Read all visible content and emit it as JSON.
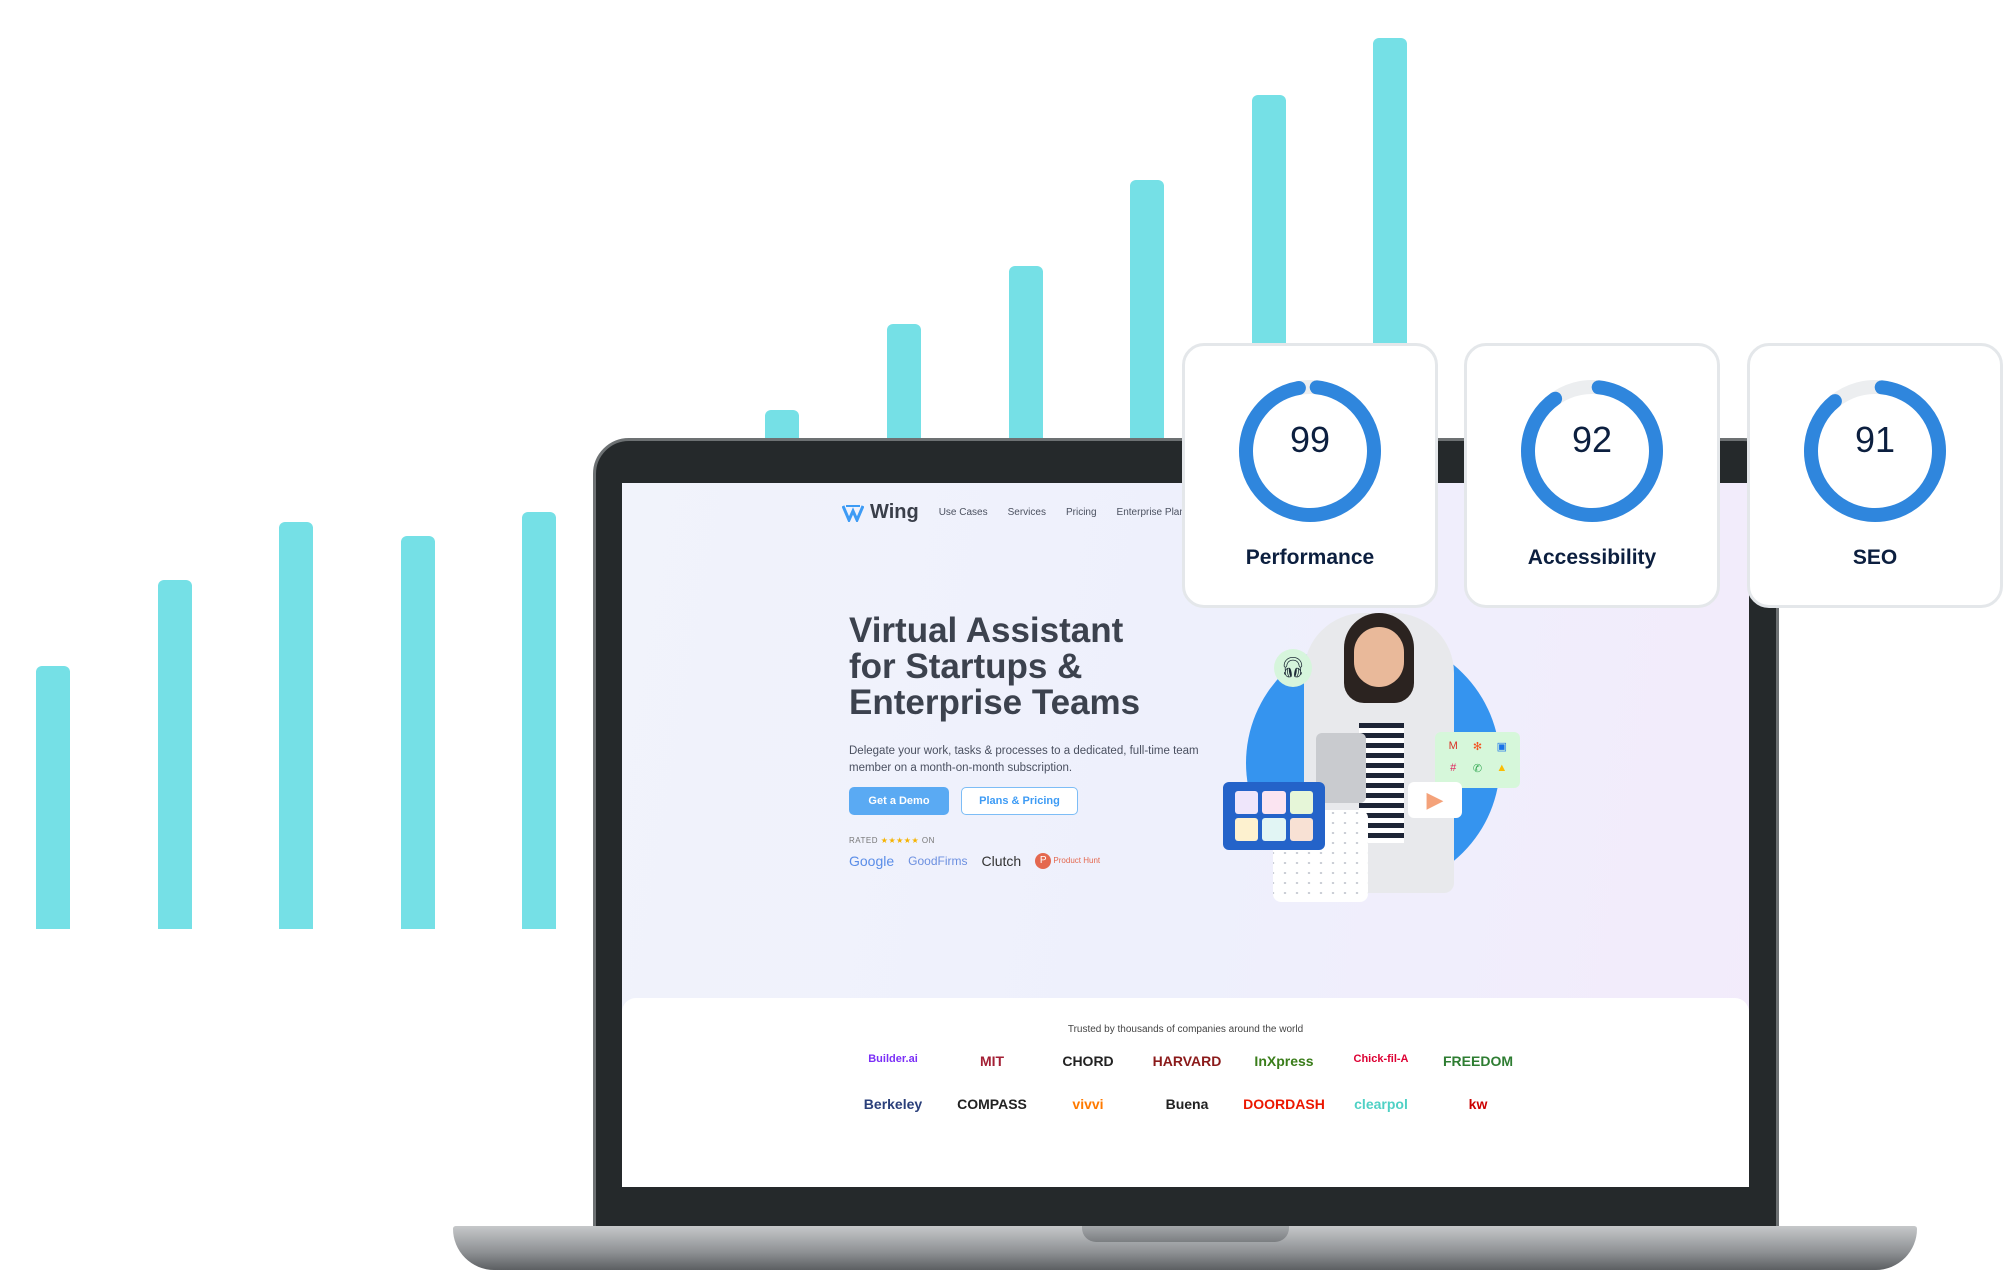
{
  "website": {
    "logo": "Wing",
    "nav": [
      "Use Cases",
      "Services",
      "Pricing",
      "Enterprise Plans"
    ],
    "headline": [
      "Virtual Assistant",
      "for Startups &",
      "Enterprise Teams"
    ],
    "subtitle": "Delegate your work, tasks & processes to a dedicated, full-time team member on a month-on-month subscription.",
    "primary_button": "Get a Demo",
    "secondary_button": "Plans & Pricing",
    "rated_prefix": "RATED",
    "rated_stars": "★★★★★",
    "rated_suffix": "ON",
    "review_sites": [
      "Google",
      "GoodFirms",
      "Clutch",
      "Product Hunt"
    ],
    "trusted_title": "Trusted by thousands of companies around the world",
    "companies_row1": [
      "Builder.ai",
      "MIT",
      "CHORD",
      "HARVARD",
      "InXpress",
      "Chick-fil-A",
      "FREEDOM"
    ],
    "companies_row2": [
      "Berkeley",
      "COMPASS",
      "vivvi",
      "Buena",
      "DOORDASH",
      "clearpol",
      "kw"
    ],
    "brand_color": "#3d9bf5"
  },
  "scores": [
    {
      "value": 99,
      "label": "Performance"
    },
    {
      "value": 92,
      "label": "Accessibility"
    },
    {
      "value": 91,
      "label": "SEO"
    }
  ],
  "colors": {
    "ring": "#2f86dd",
    "ring_track": "#eceef0",
    "bars": "#75e0e6"
  }
}
